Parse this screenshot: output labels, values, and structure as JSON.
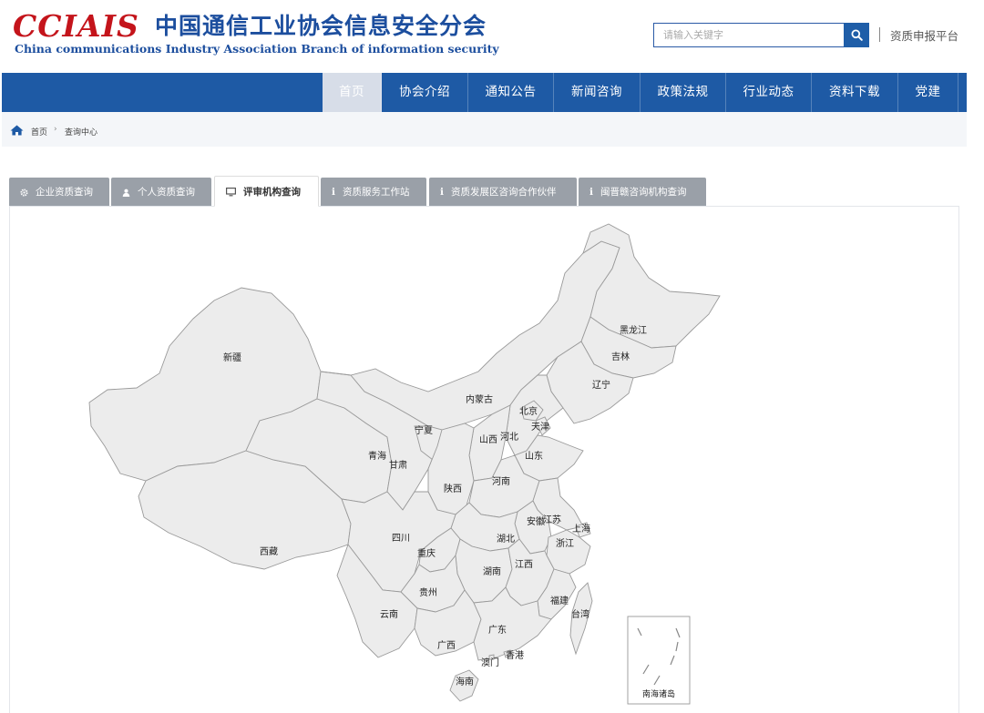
{
  "header": {
    "logo_mark": "CCIAIS",
    "logo_cn": "中国通信工业协会信息安全分会",
    "logo_en": "China communications Industry Association Branch of information security",
    "search_placeholder": "请输入关键字",
    "search_icon": "search-icon",
    "platform_link": "资质申报平台"
  },
  "nav": {
    "items": [
      {
        "label": "首页",
        "active": true
      },
      {
        "label": "协会介绍"
      },
      {
        "label": "通知公告"
      },
      {
        "label": "新闻咨询"
      },
      {
        "label": "政策法规"
      },
      {
        "label": "行业动态"
      },
      {
        "label": "资料下载"
      },
      {
        "label": "党建"
      }
    ]
  },
  "breadcrumb": {
    "home_icon": "home-icon",
    "home": "首页",
    "separator": "›",
    "current": "查询中心"
  },
  "tabs": [
    {
      "label": "企业资质查询",
      "icon": "gear-icon"
    },
    {
      "label": "个人资质查询",
      "icon": "user-icon"
    },
    {
      "label": "评审机构查询",
      "icon": "monitor-icon",
      "active": true
    },
    {
      "label": "资质服务工作站",
      "icon": "info-icon"
    },
    {
      "label": "资质发展区咨询合作伙伴",
      "icon": "info-icon"
    },
    {
      "label": "闽晋赣咨询机构查询",
      "icon": "info-icon"
    }
  ],
  "map": {
    "provinces": {
      "xinjiang": "新疆",
      "xizang": "西藏",
      "qinghai": "青海",
      "gansu": "甘肃",
      "neimenggu": "内蒙古",
      "heilongjiang": "黑龙江",
      "jilin": "吉林",
      "liaoning": "辽宁",
      "beijing": "北京",
      "tianjin": "天津",
      "hebei": "河北",
      "shanxi": "山西",
      "shandong": "山东",
      "ningxia": "宁夏",
      "shaanxi": "陕西",
      "henan": "河南",
      "jiangsu": "江苏",
      "anhui": "安徽",
      "shanghai": "上海",
      "zhejiang": "浙江",
      "hubei": "湖北",
      "sichuan": "四川",
      "chongqing": "重庆",
      "hunan": "湖南",
      "jiangxi": "江西",
      "guizhou": "贵州",
      "yunnan": "云南",
      "guangxi": "广西",
      "guangdong": "广东",
      "fujian": "福建",
      "taiwan": "台湾",
      "xianggang": "香港",
      "aomen": "澳门",
      "hainan": "海南"
    },
    "inset_label": "南海诸岛"
  }
}
